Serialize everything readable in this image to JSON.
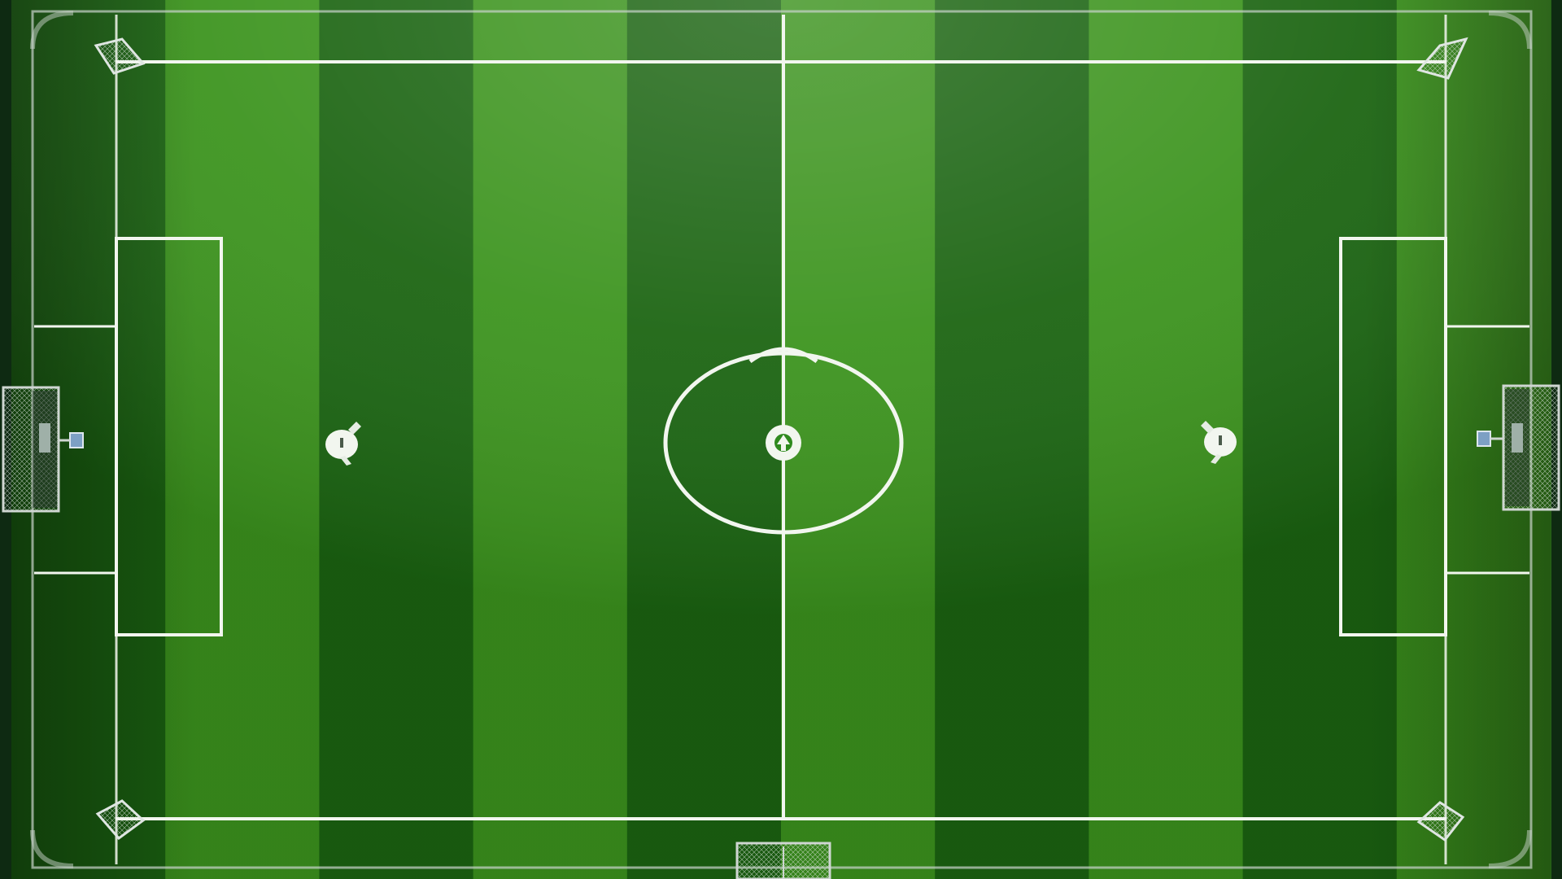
{
  "scene": {
    "title": "",
    "description_visible_text": ""
  },
  "colors": {
    "outer_background": "#0e2a12",
    "pitch_dark": "#1c6a12",
    "pitch_light": "#3f9c1f",
    "pitch_highlight": "#6cc536",
    "line_white": "#f2f6ef",
    "goal_frame": "#cfd6d2"
  },
  "pitch": {
    "stripes": 10,
    "features": [
      "center-line",
      "center-circle",
      "center-spot",
      "left-penalty-box",
      "right-penalty-box",
      "left-goal",
      "right-goal",
      "bottom-goal",
      "corner-goals"
    ]
  },
  "players": [
    {
      "id": "left-player",
      "side": "left"
    },
    {
      "id": "right-player",
      "side": "right"
    }
  ]
}
